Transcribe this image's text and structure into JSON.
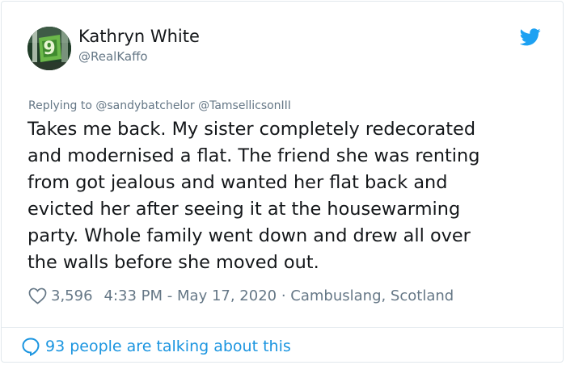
{
  "tweet": {
    "author_name": "Kathryn White",
    "author_handle": "@RealKaffo",
    "replying_to": "Replying to @sandybatchelor @TamsellicsonIII",
    "text": "Takes me back.  My sister completely redecorated\nand modernised a flat.  The friend she was renting\nfrom got jealous and wanted her flat back and\nevicted her after seeing it at the housewarming\nparty.  Whole family went down and drew all over\nthe walls before she moved out.",
    "likes": "3,596",
    "time": "4:33 PM",
    "date_sep": " - ",
    "date": "May 17, 2020",
    "dot_sep": " · ",
    "location": "Cambuslang, Scotland",
    "talking": "93 people are talking about this"
  },
  "colors": {
    "twitter_blue": "#1da1f2",
    "link_blue": "#1b95e0",
    "secondary_text": "#657786",
    "primary_text": "#14171a"
  },
  "icons": [
    "avatar-icon",
    "twitter-bird-icon",
    "heart-icon",
    "speech-bubble-icon"
  ]
}
